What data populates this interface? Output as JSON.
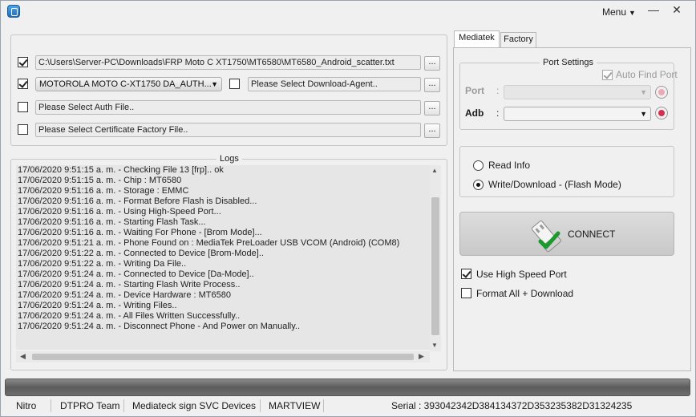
{
  "window": {
    "menu_label": "Menu",
    "minimize": "—",
    "close": "✕"
  },
  "files": {
    "scatter_path": "C:\\Users\\Server-PC\\Downloads\\FRP Moto C XT1750\\MT6580\\MT6580_Android_scatter.txt",
    "da_selected": "MOTOROLA MOTO C-XT1750 DA_AUTH...",
    "download_agent_placeholder": "Please Select Download-Agent..",
    "auth_placeholder": "Please Select Auth File..",
    "cert_placeholder": "Please Select Certificate Factory File..",
    "browse_label": "..."
  },
  "logs": {
    "title": "Logs",
    "lines": [
      "17/06/2020 9:51:15 a. m. - Checking File 13 [frp].. ok",
      "17/06/2020 9:51:15 a. m. - Chip : MT6580",
      "17/06/2020 9:51:16 a. m. - Storage : EMMC",
      "17/06/2020 9:51:16 a. m. - Format Before Flash is Disabled...",
      "17/06/2020 9:51:16 a. m. - Using High-Speed Port...",
      "17/06/2020 9:51:16 a. m. - Starting Flash Task...",
      "17/06/2020 9:51:16 a. m. - Waiting For Phone - [Brom Mode]...",
      "17/06/2020 9:51:21 a. m. - Phone Found on : MediaTek PreLoader USB VCOM (Android) (COM8)",
      "17/06/2020 9:51:22 a. m. - Connected to Device [Brom-Mode]..",
      "17/06/2020 9:51:22 a. m. - Writing Da File..",
      "17/06/2020 9:51:24 a. m. - Connected to Device [Da-Mode]..",
      "17/06/2020 9:51:24 a. m. - Starting Flash Write Process..",
      "17/06/2020 9:51:24 a. m. - Device Hardware : MT6580",
      "17/06/2020 9:51:24 a. m. - Writing Files..",
      "17/06/2020 9:51:24 a. m. - All Files Written Successfully..",
      "17/06/2020 9:51:24 a. m. - Disconnect Phone - And Power on Manually.."
    ]
  },
  "tabs": [
    {
      "label": "Mediatek"
    },
    {
      "label": "Factory"
    }
  ],
  "port_settings": {
    "title": "Port Settings",
    "auto_find_label": "Auto Find Port",
    "port_label": "Port",
    "adb_label": "Adb",
    "colon": ":"
  },
  "modes": {
    "read_info": "Read Info",
    "write_download": "Write/Download - (Flash Mode)"
  },
  "connect_label": "CONNECT",
  "options": {
    "high_speed": "Use High Speed Port",
    "format_all": "Format All + Download"
  },
  "status_bar": {
    "items": [
      "Nitro",
      "DTPRO Team",
      "Mediateck sign SVC Devices",
      "MARTVIEW"
    ],
    "serial": "Serial : 393042342D384134372D353235382D31324235"
  }
}
